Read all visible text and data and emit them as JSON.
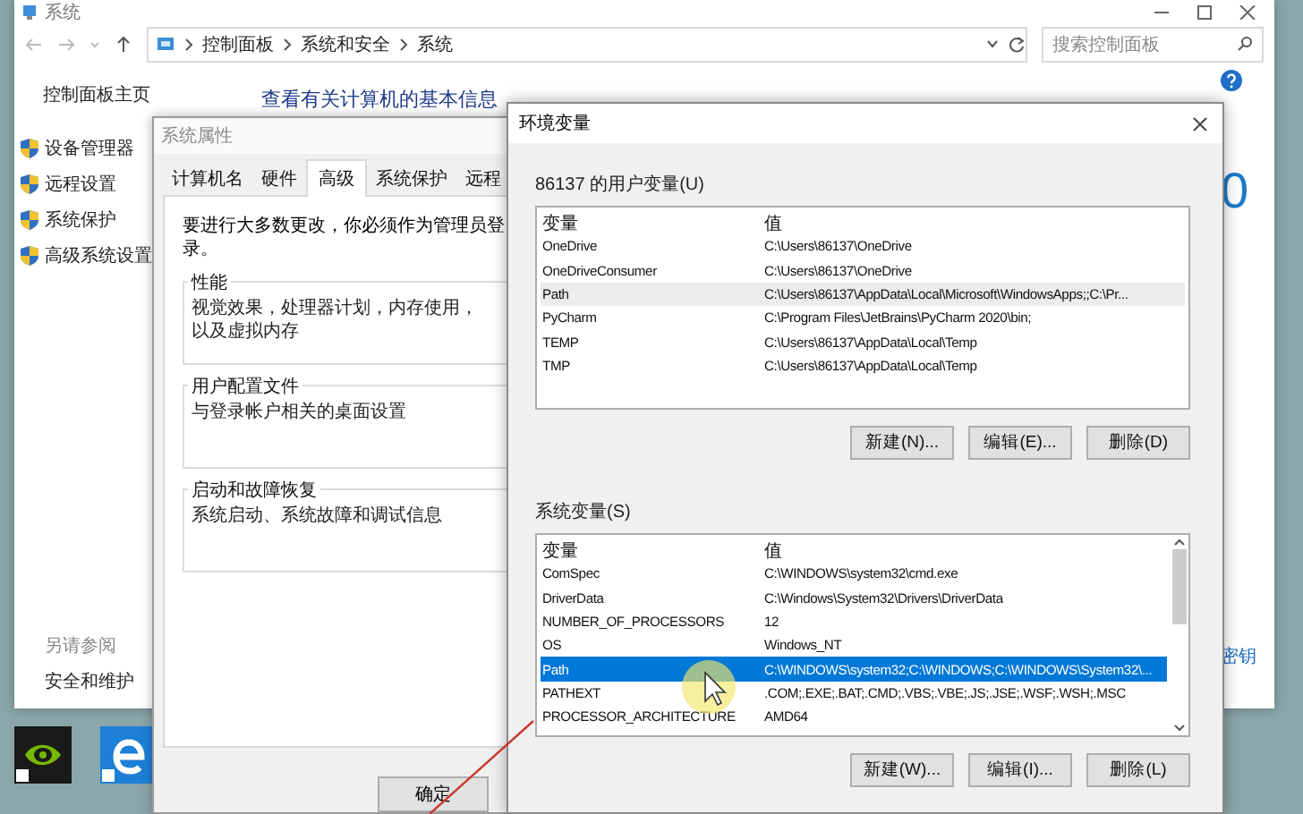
{
  "system_window": {
    "title": "系统",
    "breadcrumb": [
      "控制面板",
      "系统和安全",
      "系统"
    ],
    "search": {
      "placeholder": "搜索控制面板"
    },
    "sidebar": {
      "home": "控制面板主页",
      "links": [
        "设备管理器",
        "远程设置",
        "系统保护",
        "高级系统设置"
      ],
      "see_also_title": "另请参阅",
      "see_also_links": [
        "安全和维护"
      ]
    },
    "heading": "查看有关计算机的基本信息",
    "partial_value": "0",
    "partial_link": "密钥"
  },
  "system_properties": {
    "title": "系统属性",
    "tabs": [
      {
        "label": "计算机名",
        "selected": false
      },
      {
        "label": "硬件",
        "selected": false
      },
      {
        "label": "高级",
        "selected": true
      },
      {
        "label": "系统保护",
        "selected": false
      },
      {
        "label": "远程",
        "selected": false
      }
    ],
    "notice": "要进行大多数更改，你必须作为管理员登录。",
    "groups": [
      {
        "title": "性能",
        "description": "视觉效果，处理器计划，内存使用，以及虚拟内存"
      },
      {
        "title": "用户配置文件",
        "description": "与登录帐户相关的桌面设置"
      },
      {
        "title": "启动和故障恢复",
        "description": "系统启动、系统故障和调试信息"
      }
    ],
    "buttons": [
      "确定"
    ]
  },
  "environment_variables": {
    "title": "环境变量",
    "user_variables": {
      "label": "86137 的用户变量(U)",
      "focused": false,
      "columns": [
        "变量",
        "值"
      ],
      "rows": [
        {
          "name": "OneDrive",
          "value": "C:\\Users\\86137\\OneDrive",
          "selected": false
        },
        {
          "name": "OneDriveConsumer",
          "value": "C:\\Users\\86137\\OneDrive",
          "selected": false
        },
        {
          "name": "Path",
          "value": "C:\\Users\\86137\\AppData\\Local\\Microsoft\\WindowsApps;;C:\\Pr...",
          "selected": true
        },
        {
          "name": "PyCharm",
          "value": "C:\\Program Files\\JetBrains\\PyCharm 2020\\bin;",
          "selected": false
        },
        {
          "name": "TEMP",
          "value": "C:\\Users\\86137\\AppData\\Local\\Temp",
          "selected": false
        },
        {
          "name": "TMP",
          "value": "C:\\Users\\86137\\AppData\\Local\\Temp",
          "selected": false
        }
      ],
      "buttons": [
        "新建(N)...",
        "编辑(E)...",
        "删除(D)"
      ]
    },
    "system_variables": {
      "label": "系统变量(S)",
      "focused": true,
      "columns": [
        "变量",
        "值"
      ],
      "rows": [
        {
          "name": "ComSpec",
          "value": "C:\\WINDOWS\\system32\\cmd.exe",
          "selected": false
        },
        {
          "name": "DriverData",
          "value": "C:\\Windows\\System32\\Drivers\\DriverData",
          "selected": false
        },
        {
          "name": "NUMBER_OF_PROCESSORS",
          "value": "12",
          "selected": false
        },
        {
          "name": "OS",
          "value": "Windows_NT",
          "selected": false
        },
        {
          "name": "Path",
          "value": "C:\\WINDOWS\\system32;C:\\WINDOWS;C:\\WINDOWS\\System32\\...",
          "selected": true
        },
        {
          "name": "PATHEXT",
          "value": ".COM;.EXE;.BAT;.CMD;.VBS;.VBE;.JS;.JSE;.WSF;.WSH;.MSC",
          "selected": false
        },
        {
          "name": "PROCESSOR_ARCHITECTURE",
          "value": "AMD64",
          "selected": false
        }
      ],
      "buttons": [
        "新建(W)...",
        "编辑(I)...",
        "删除(L)"
      ]
    }
  }
}
